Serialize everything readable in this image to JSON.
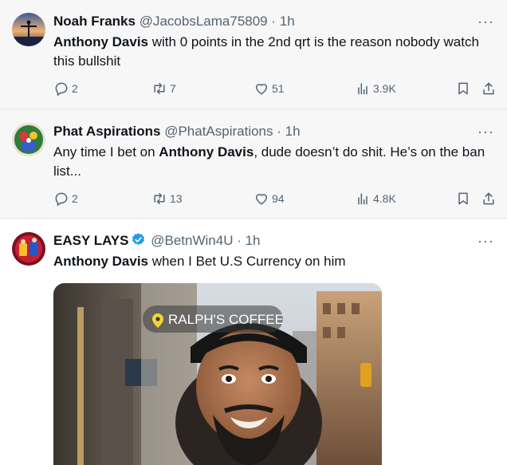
{
  "tweets": [
    {
      "name": "Noah Franks",
      "handle": "@JacobsLama75809",
      "time": "1h",
      "text_plain_before": "",
      "text_bold": "Anthony Davis",
      "text_after": " with 0 points in the 2nd qrt is the reason nobody watch this bullshit",
      "replies": "2",
      "reposts": "7",
      "likes": "51",
      "views": "3.9K"
    },
    {
      "name": "Phat Aspirations",
      "handle": "@PhatAspirations",
      "time": "1h",
      "text_plain_before": "Any time I bet on ",
      "text_bold": "Anthony Davis",
      "text_after": ", dude doesn’t do shit. He’s on the ban list...",
      "replies": "2",
      "reposts": "13",
      "likes": "94",
      "views": "4.8K"
    },
    {
      "name": "EASY LAYS",
      "handle": "@BetnWin4U",
      "time": "1h",
      "text_plain_before": "",
      "text_bold": "Anthony Davis",
      "text_after": " when I Bet U.S Currency on him",
      "media_location": "RALPH'S COFFEE"
    }
  ],
  "separator": " · ",
  "more_label": "···",
  "colors": {
    "name": "#0f1419",
    "secondary": "#536471",
    "verified": "#1d9bf0",
    "background_muted": "#f7f7f8"
  },
  "icons": {
    "reply": "reply-icon",
    "repost": "repost-icon",
    "like": "like-icon",
    "views": "views-icon",
    "bookmark": "bookmark-icon",
    "share": "share-icon",
    "verified": "verified-badge-icon",
    "location": "location-pin-icon"
  }
}
